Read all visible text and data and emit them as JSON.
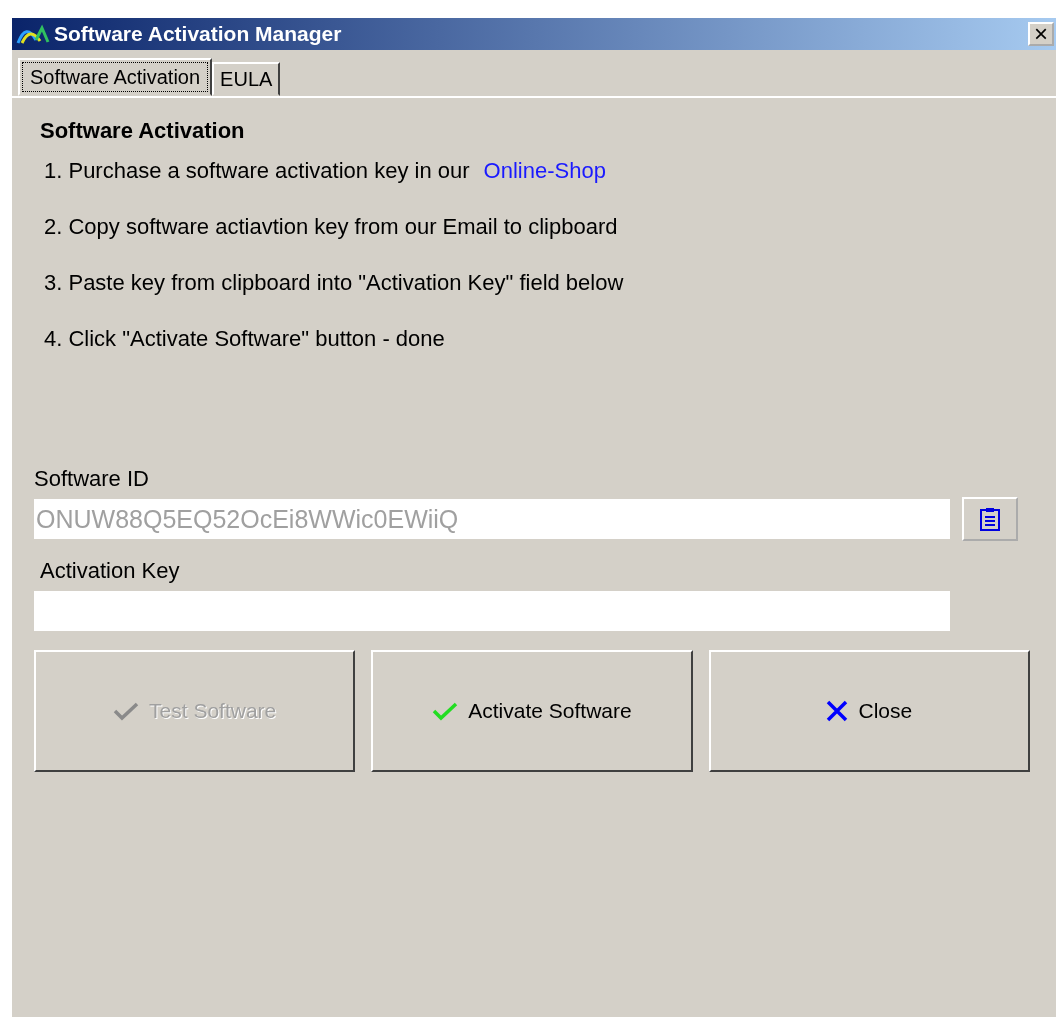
{
  "window": {
    "title": "Software Activation Manager",
    "close": "×"
  },
  "tabs": [
    {
      "label": "Software Activation",
      "selected": true
    },
    {
      "label": "EULA",
      "selected": false
    }
  ],
  "heading": "Software Activation",
  "steps": [
    {
      "text": "1. Purchase a software activation key in our",
      "link": "Online-Shop"
    },
    {
      "text": "2. Copy software actiavtion key from our Email to clipboard"
    },
    {
      "text": "3. Paste key from clipboard into \"Activation Key\" field below"
    },
    {
      "text": "4. Click \"Activate Software\" button - done"
    }
  ],
  "software_id": {
    "label": "Software ID",
    "value": "ONUW88Q5EQ52OcEi8WWic0EWiiQ"
  },
  "activation_key": {
    "label": "Activation Key"
  },
  "buttons": [
    {
      "label": "Test Software",
      "kind": "check",
      "disabled": true
    },
    {
      "label": "Activate Software",
      "kind": "check",
      "disabled": false
    },
    {
      "label": "Close",
      "kind": "close",
      "disabled": false
    }
  ]
}
